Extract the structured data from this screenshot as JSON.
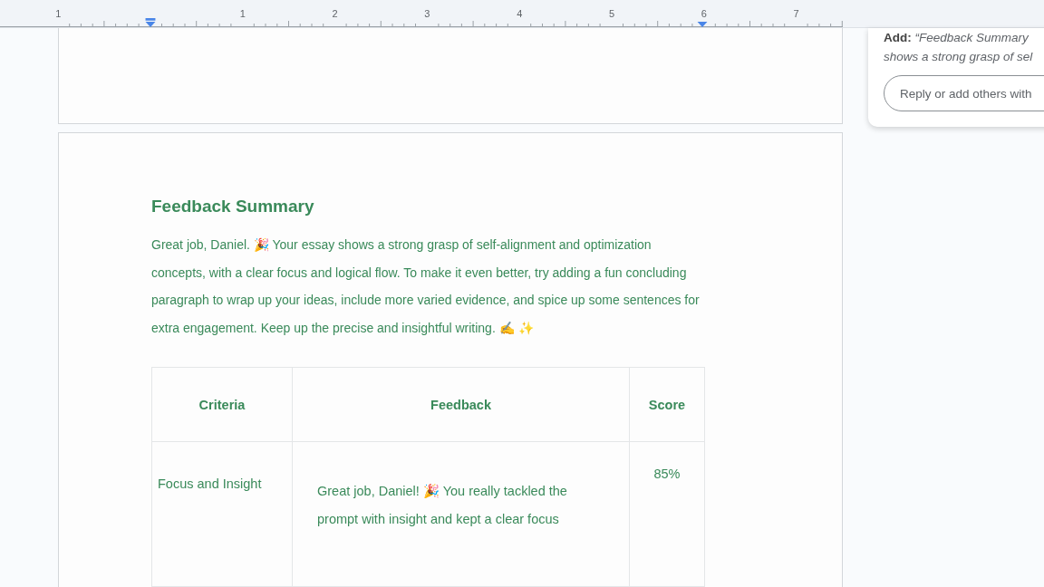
{
  "ruler": {
    "labels": [
      "1",
      "1",
      "2",
      "3",
      "4",
      "5",
      "6",
      "7"
    ]
  },
  "document": {
    "heading": "Feedback Summary",
    "summary": "Great job, Daniel. 🎉  Your essay shows a strong grasp of self-alignment and optimization concepts, with a clear focus and logical flow. To make it even better, try adding a fun concluding paragraph to wrap up your ideas, include more varied evidence, and spice up some sentences for extra engagement. Keep up the precise and insightful writing. ✍️ ✨",
    "table": {
      "columns": [
        "Criteria",
        "Feedback",
        "Score"
      ],
      "rows": [
        {
          "criteria": "Focus and Insight",
          "feedback": "Great job, Daniel! 🎉  You really tackled the prompt with insight and kept a clear focus",
          "score": "85%"
        }
      ]
    }
  },
  "comment": {
    "author_action": "Add:",
    "quote": "“Feedback Summary",
    "quote_line_2": "shows a strong grasp of sel",
    "reply": {
      "placeholder": "Reply or add others with"
    }
  }
}
